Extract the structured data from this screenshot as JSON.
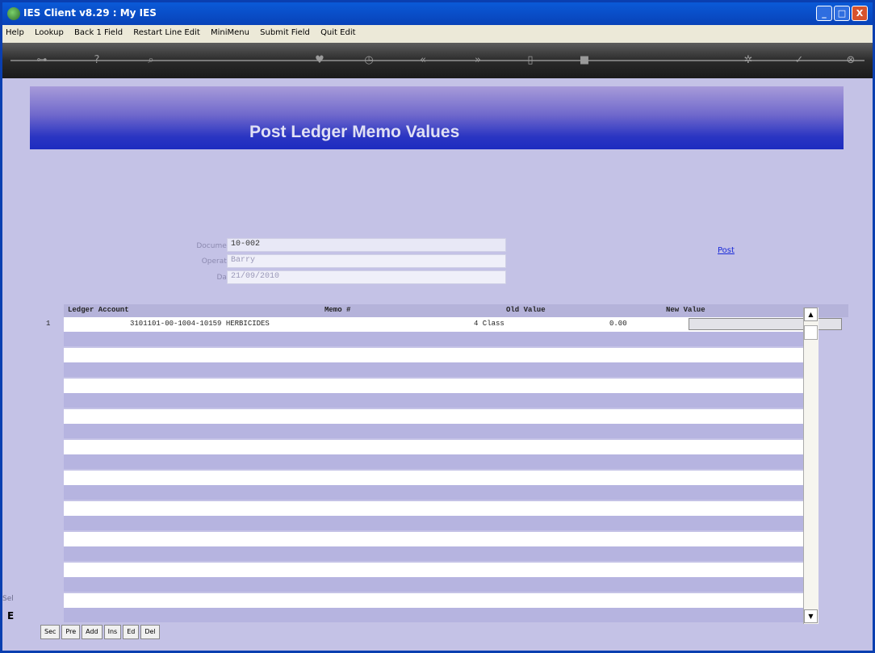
{
  "window": {
    "title": "IES Client v8.29 : My IES"
  },
  "titlebar_buttons": {
    "minimize": "_",
    "maximize": "□",
    "close": "X"
  },
  "menu": [
    "Help",
    "Lookup",
    "Back 1 Field",
    "Restart Line Edit",
    "MiniMenu",
    "Submit Field",
    "Quit Edit"
  ],
  "toolbar_icons": [
    "key-icon",
    "help-icon",
    "search-icon",
    "heart-icon",
    "clock-icon",
    "prev-icon",
    "next-icon",
    "document-icon",
    "stop-icon",
    "gear-icon",
    "ok-icon",
    "close-icon"
  ],
  "banner": {
    "title": "Post Ledger Memo Values"
  },
  "form": {
    "document_label": "Document",
    "document_value": "10-002",
    "operator_label": "Operator",
    "operator_value": "Barry",
    "date_label": "Date",
    "date_value": "21/09/2010",
    "post_link": "Post"
  },
  "grid": {
    "columns": [
      "Ledger Account",
      "Memo #",
      "Old Value",
      "New Value"
    ],
    "rows": [
      {
        "num": "1",
        "ledger": "3101101-00-1004-10159 HERBICIDES",
        "memo": "4 Class",
        "old_value": "0.00",
        "new_value": ""
      }
    ]
  },
  "bottom_buttons": [
    "Sec",
    "Pre",
    "Add",
    "Ins",
    "Ed",
    "Del"
  ],
  "side_hint": "Sel",
  "side_hint2": "E"
}
